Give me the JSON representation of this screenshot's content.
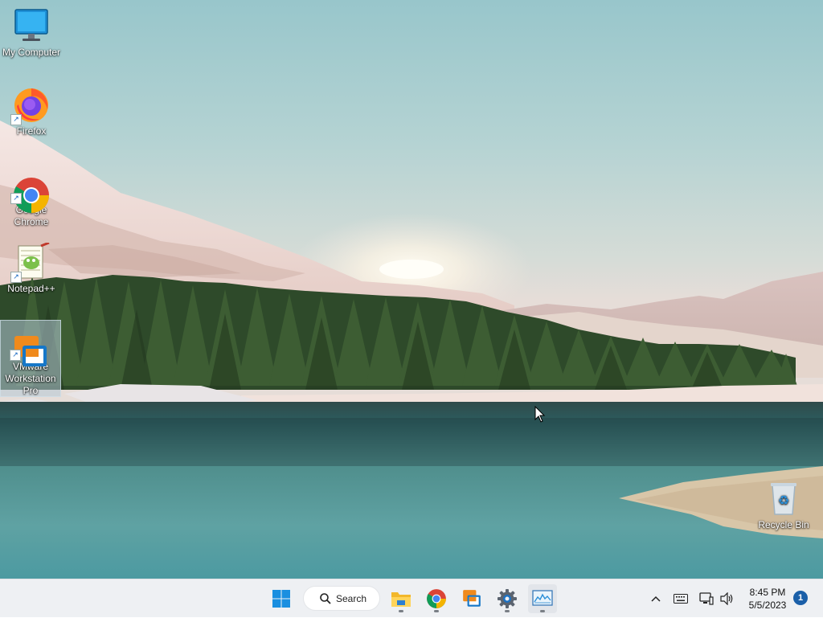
{
  "desktop": {
    "icons": [
      {
        "label": "My Computer",
        "icon": "monitor-icon"
      },
      {
        "label": "Firefox",
        "icon": "firefox-icon"
      },
      {
        "label": "Google\nChrome",
        "icon": "chrome-icon"
      },
      {
        "label": "Notepad++",
        "icon": "notepadpp-icon"
      },
      {
        "label": "VMware\nWorkstation\nPro",
        "icon": "vmware-icon",
        "selected": true
      },
      {
        "label": "Recycle Bin",
        "icon": "recycle-bin-icon"
      }
    ]
  },
  "taskbar": {
    "search_label": "Search",
    "apps": [
      {
        "name": "File Explorer",
        "icon": "folder-icon"
      },
      {
        "name": "Google Chrome",
        "icon": "chrome-icon"
      },
      {
        "name": "VMware Workstation",
        "icon": "vmware-icon"
      },
      {
        "name": "Settings",
        "icon": "gear-icon"
      },
      {
        "name": "Resource Monitor",
        "icon": "performance-monitor-icon"
      }
    ],
    "tray": {
      "time": "8:45 PM",
      "date": "5/5/2023",
      "notification_count": "1"
    }
  },
  "colors": {
    "taskbar_bg": "#eef0f3",
    "accent": "#1a5fa8"
  }
}
